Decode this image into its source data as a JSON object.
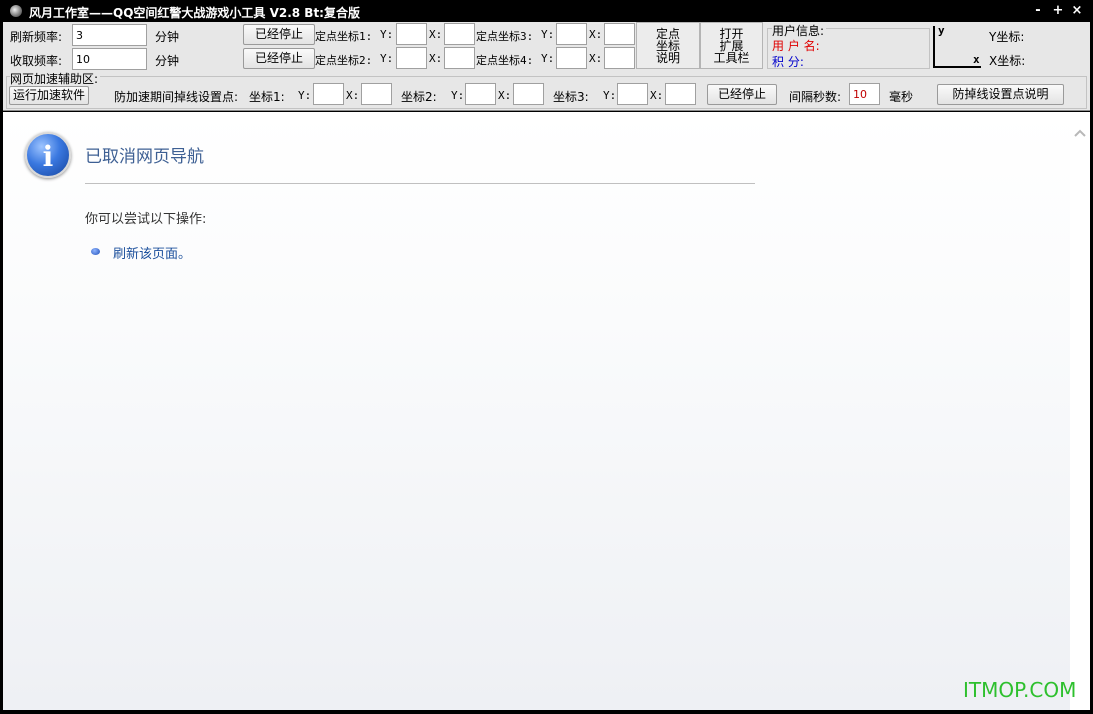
{
  "window": {
    "title": "风月工作室——QQ空间红警大战游戏小工具 V2.8 Bt:复合版",
    "minimize": "-",
    "maximize": "+",
    "close": "×"
  },
  "toolbar": {
    "refresh_freq_label": "刷新频率:",
    "refresh_freq_value": "3",
    "refresh_unit": "分钟",
    "collect_freq_label": "收取频率:",
    "collect_freq_value": "10",
    "collect_unit": "分钟",
    "stop_btn_1": "已经停止",
    "stop_btn_2": "已经停止",
    "coord1_label": "定点坐标1:",
    "coord2_label": "定点坐标2:",
    "coord3_label": "定点坐标3:",
    "coord4_label": "定点坐标4:",
    "y_label": "Y:",
    "x_label": "X:",
    "coord_help_btn": [
      "定点",
      "坐标",
      "说明"
    ],
    "open_toolbar_btn": [
      "打开",
      "扩展",
      "工具栏"
    ],
    "user_info": {
      "header": "用户信息:",
      "username_label": "用 户 名:",
      "points_label": "积    分:",
      "username_color": "#e00000",
      "points_color": "#0000cc"
    },
    "axis": {
      "y_axis": "y",
      "x_axis": "x",
      "y_coord_label": "Y坐标:",
      "x_coord_label": "X坐标:"
    },
    "accel_group_label": "网页加速辅助区:",
    "run_accel_btn": "运行加速软件",
    "anti_drop_label": "防加速期间掉线设置点:",
    "point1_label": "坐标1:",
    "point2_label": "坐标2:",
    "point3_label": "坐标3:",
    "stop_btn_3": "已经停止",
    "interval_label": "间隔秒数:",
    "interval_value": "10",
    "interval_unit": "毫秒",
    "anti_drop_help_btn": "防掉线设置点说明"
  },
  "browser": {
    "title": "已取消网页导航",
    "try_text": "你可以尝试以下操作:",
    "refresh_link": "刷新该页面。",
    "icon": "info-icon"
  },
  "watermark": "ITMOP.COM"
}
